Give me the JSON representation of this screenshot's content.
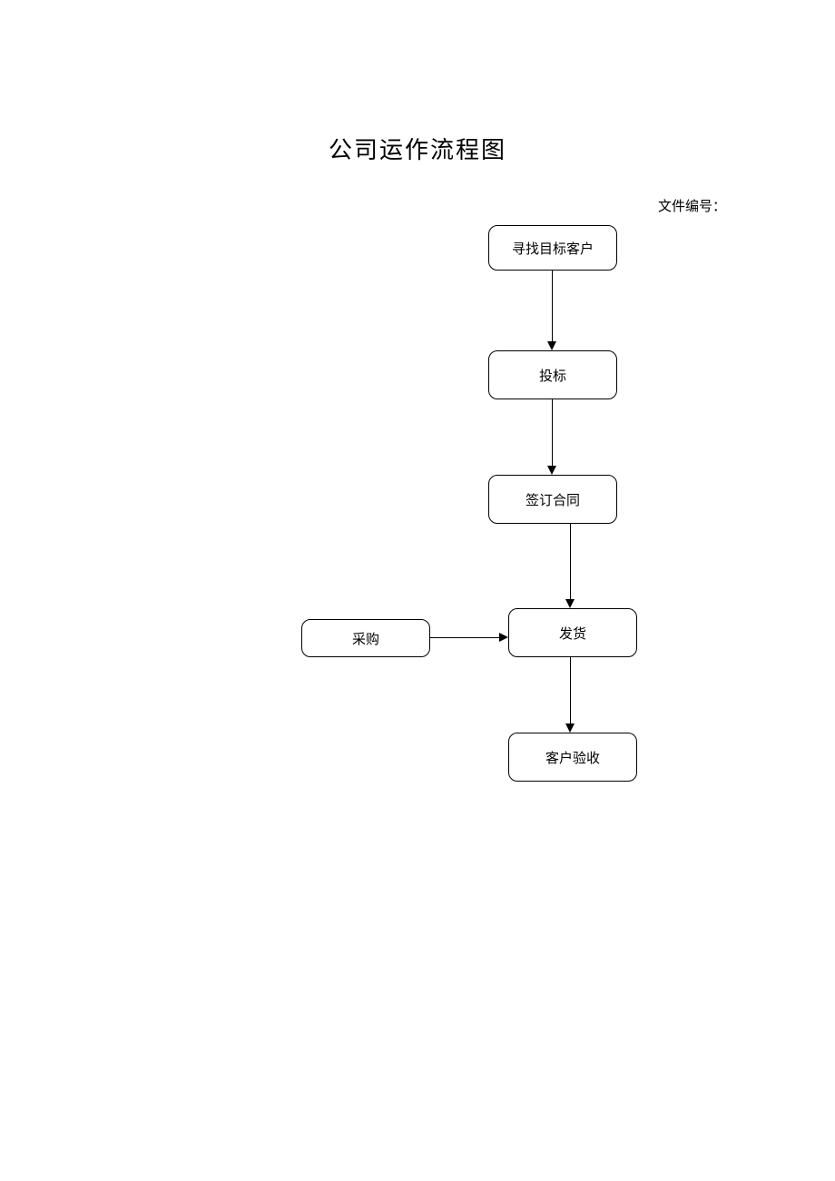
{
  "title": "公司运作流程图",
  "doc_number_label": "文件编号：",
  "nodes": {
    "n1": "寻找目标客户",
    "n2": "投标",
    "n3": "签订合同",
    "n4": "发货",
    "n5": "客户验收",
    "side": "采购"
  }
}
